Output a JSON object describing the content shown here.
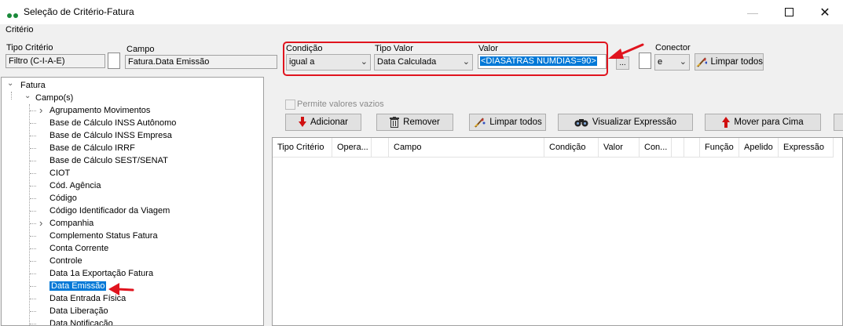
{
  "window": {
    "title": "Seleção de Critério-Fatura",
    "section_label": "Critério"
  },
  "criteria_bar": {
    "tipo_criterio_label": "Tipo Critério",
    "tipo_criterio_value": "Filtro (C-I-A-E)",
    "campo_label": "Campo",
    "campo_value": "Fatura.Data Emissão",
    "condicao_label": "Condição",
    "condicao_value": "igual a",
    "tipo_valor_label": "Tipo Valor",
    "tipo_valor_value": "Data Calculada",
    "valor_label": "Valor",
    "valor_value": "<DIASATRAS NUMDIAS=90>",
    "valor_browse": "...",
    "conector_label": "Conector",
    "conector_value": "e",
    "limpar_todos_label": "Limpar todos"
  },
  "options": {
    "permite_vazios_label": "Permite valores vazios"
  },
  "toolbar": {
    "adicionar": "Adicionar",
    "remover": "Remover",
    "limpar_todos": "Limpar todos",
    "visualizar": "Visualizar Expressão",
    "mover_cima": "Mover para Cima"
  },
  "tree": {
    "root": "Fatura",
    "group": "Campo(s)",
    "items": [
      "Agrupamento Movimentos",
      "Base de Cálculo INSS Autônomo",
      "Base de Cálculo INSS Empresa",
      "Base de Cálculo IRRF",
      "Base de Cálculo SEST/SENAT",
      "CIOT",
      "Cód. Agência",
      "Código",
      "Código Identificador da Viagem",
      "Companhia",
      "Complemento Status Fatura",
      "Conta Corrente",
      "Controle",
      "Data 1a Exportação Fatura",
      "Data Emissão",
      "Data Entrada Física",
      "Data Liberação",
      "Data Notificação"
    ],
    "expandable": [
      "Agrupamento Movimentos",
      "Companhia"
    ],
    "selected": "Data Emissão"
  },
  "grid": {
    "columns": [
      "Tipo Critério",
      "Opera...",
      "",
      "Campo",
      "Condição",
      "Valor",
      "Con...",
      "",
      "",
      "Função",
      "Apelido",
      "Expressão"
    ]
  },
  "colors": {
    "accent": "#0078d7",
    "annotation": "#e0141e"
  }
}
